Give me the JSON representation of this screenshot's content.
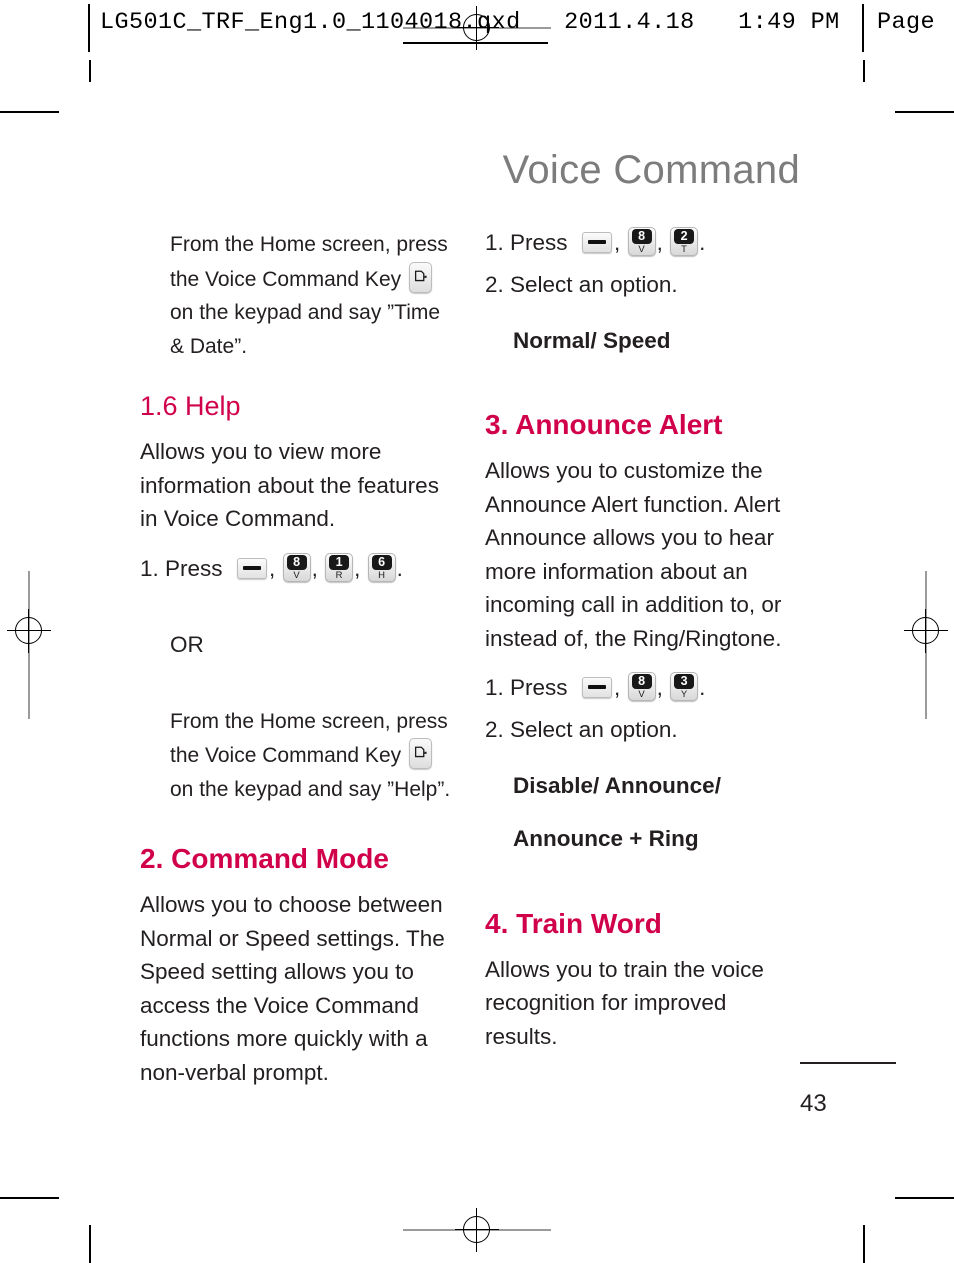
{
  "header": {
    "filename": "LG501C_TRF_Eng1.0_1104018.qxd",
    "date": "2011.4.18",
    "time": "1:49 PM",
    "page_label": "Page",
    "full_line": "LG501C_TRF_Eng1.0_1104018.qxd   2011.4.18   1:49 PM"
  },
  "document": {
    "title": "Voice Command",
    "page_number": "43"
  },
  "left_column": {
    "intro": {
      "line1": "From the Home screen, press",
      "line2_before_key": "the Voice Command Key",
      "key_icon": "voice-command-key-icon",
      "line3": "on the keypad and say ”Time",
      "line4": "& Date”."
    },
    "section_help": {
      "heading": "1.6 Help",
      "body": "Allows you to view more information about the features in Voice Command.",
      "step1_label": "1. Press",
      "step1_keys": [
        {
          "icon": "menu-key-icon",
          "type": "bar"
        },
        {
          "icon": "key-8-v",
          "digit": "8",
          "letter": "V"
        },
        {
          "icon": "key-1-r",
          "digit": "1",
          "letter": "R"
        },
        {
          "icon": "key-6-h",
          "digit": "6",
          "letter": "H"
        }
      ],
      "step1_terminator": ".",
      "or_label": "OR",
      "or_line1": "From the Home screen, press",
      "or_line2_before_key": "the Voice Command Key",
      "or_key_icon": "voice-command-key-icon",
      "or_line3": "on the keypad and say ”Help”."
    },
    "section_command_mode": {
      "heading": "2. Command Mode",
      "body": "Allows you to choose between Normal or Speed settings. The Speed setting allows you to access the Voice Command functions more quickly with a non-verbal prompt."
    }
  },
  "right_column": {
    "command_mode_steps": {
      "step1_label": "1. Press",
      "step1_keys": [
        {
          "icon": "menu-key-icon",
          "type": "bar"
        },
        {
          "icon": "key-8-v",
          "digit": "8",
          "letter": "V"
        },
        {
          "icon": "key-2-t",
          "digit": "2",
          "letter": "T"
        }
      ],
      "step1_terminator": ".",
      "step2_label": "2. Select an option.",
      "options": "Normal/ Speed"
    },
    "section_announce_alert": {
      "heading": "3. Announce Alert",
      "body": "Allows you to customize the Announce Alert function. Alert Announce allows you to hear more information about an incoming call in addition to, or instead of, the Ring/Ringtone.",
      "step1_label": "1. Press",
      "step1_keys": [
        {
          "icon": "menu-key-icon",
          "type": "bar"
        },
        {
          "icon": "key-8-v",
          "digit": "8",
          "letter": "V"
        },
        {
          "icon": "key-3-y",
          "digit": "3",
          "letter": "Y"
        }
      ],
      "step1_terminator": ".",
      "step2_label": "2. Select an option.",
      "options_line1": "Disable/ Announce/",
      "options_line2": "Announce + Ring"
    },
    "section_train_word": {
      "heading": "4. Train Word",
      "body": "Allows you to train the voice recognition for improved results."
    }
  },
  "colors": {
    "heading_accent": "#d0004b",
    "title_gray": "#7c7c7c",
    "body_text": "#231f20"
  }
}
